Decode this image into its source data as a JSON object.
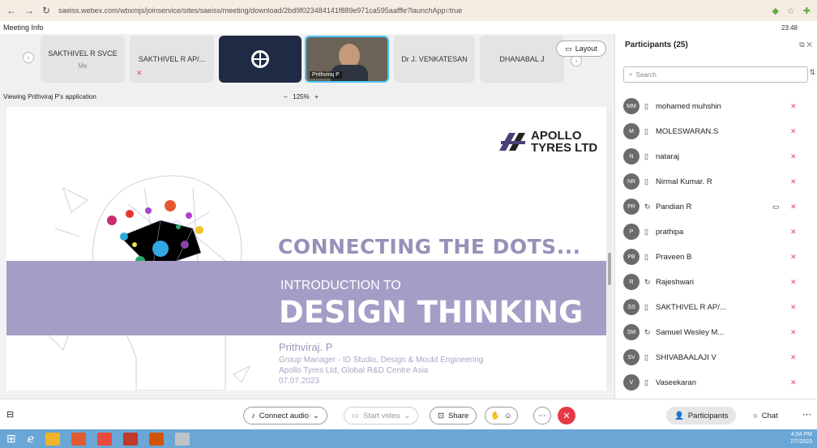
{
  "browser": {
    "url": "saeiss.webex.com/wbxmjs/joinservice/sites/saeiss/meeting/download/2bd9f023484141f889e971ca595aafffe?launchApp=true"
  },
  "meeting": {
    "info": "Meeting Info",
    "time": "23:48"
  },
  "strip": {
    "tiles": [
      {
        "name": "SAKTHIVEL R SVCE",
        "sub": "Me"
      },
      {
        "name": "SAKTHIVEL R AP/..."
      },
      {
        "name": ""
      },
      {
        "name": "Prithviraj P"
      },
      {
        "name": "Dr J. VENKATESAN"
      },
      {
        "name": "DHANABAL J"
      }
    ],
    "layout_label": "Layout"
  },
  "viewing": {
    "label": "Viewing Prithviraj P's application",
    "zoom": "125%"
  },
  "slide": {
    "logo_line1": "APOLLO",
    "logo_line2": "TYRES LTD",
    "headline": "CONNECTING THE DOTS...",
    "intro": "INTRODUCTION TO",
    "title": "DESIGN THINKING",
    "author": "Prithviraj. P",
    "role": "Group Manager - ID Studio, Design & Mould Engineering",
    "org": "Apollo Tyres Ltd, Global R&D Centre Asia",
    "date": "07.07.2023"
  },
  "participants": {
    "title": "Participants (25)",
    "search_placeholder": "Search",
    "list": [
      {
        "initials": "MM",
        "name": "mohamed muhshin",
        "device": "phone"
      },
      {
        "initials": "M",
        "name": "MOLESWARAN.S",
        "device": "phone"
      },
      {
        "initials": "N",
        "name": "nataraj",
        "device": "phone"
      },
      {
        "initials": "NR",
        "name": "Nirmal Kumar. R",
        "device": "phone"
      },
      {
        "initials": "PR",
        "name": "Pandian R",
        "device": "audio"
      },
      {
        "initials": "P",
        "name": "prathipa",
        "device": "phone"
      },
      {
        "initials": "PB",
        "name": "Praveen B",
        "device": "phone"
      },
      {
        "initials": "R",
        "name": "Rajeshwari",
        "device": "audio"
      },
      {
        "initials": "SS",
        "name": "SAKTHIVEL R AP/...",
        "device": "phone"
      },
      {
        "initials": "SM",
        "name": "Samuel Wesley M...",
        "device": "audio"
      },
      {
        "initials": "SV",
        "name": "SHIVABAALAJI V",
        "device": "phone"
      },
      {
        "initials": "V",
        "name": "Vaseekaran",
        "device": "phone"
      }
    ]
  },
  "controls": {
    "audio": "Connect audio",
    "video": "Start video",
    "share": "Share",
    "participants": "Participants",
    "chat": "Chat"
  },
  "taskbar": {
    "time": "4:04 PM",
    "date": "7/7/2023"
  },
  "colors": {
    "accent": "#a59dc6",
    "end": "#e63946"
  }
}
